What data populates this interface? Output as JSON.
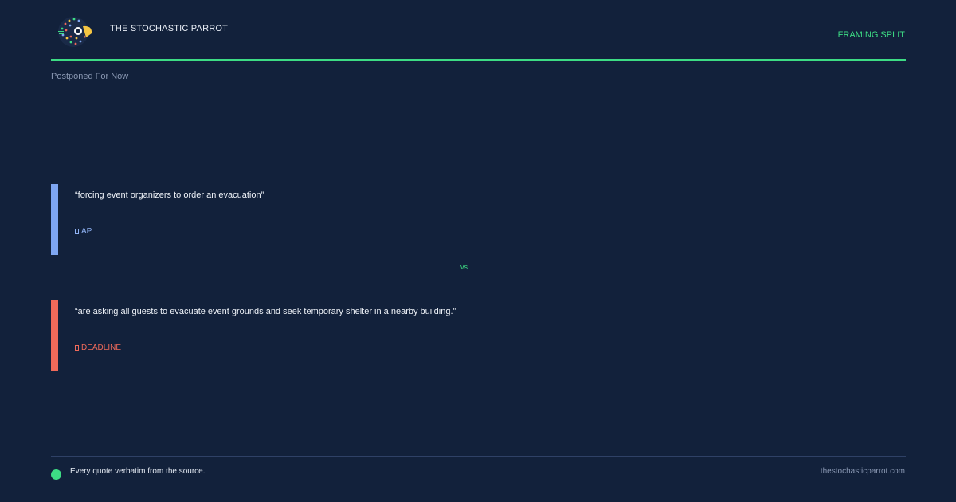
{
  "header": {
    "logo_icon": "parrot-logo-icon",
    "brand_name": "THE STOCHASTIC PARROT",
    "tag": "FRAMING SPLIT"
  },
  "headline": "Postponed For Now",
  "quotes": [
    {
      "text": "“forcing event organizers to order an evacuation”",
      "source_icon": "document-icon",
      "source": "AP",
      "accent_color": "#7ea6f2"
    },
    {
      "text": "“are asking all guests to evacuate event grounds and seek temporary shelter in a nearby building.”",
      "source_icon": "document-icon",
      "source": "DEADLINE",
      "accent_color": "#ef6a5a"
    }
  ],
  "vs_label": "vs",
  "footer": {
    "note": "Every quote verbatim from the source.",
    "domain": "thestochasticparrot.com"
  },
  "colors": {
    "background": "#12213b",
    "accent_green": "#3ddc84",
    "muted_text": "#8a98b3"
  }
}
